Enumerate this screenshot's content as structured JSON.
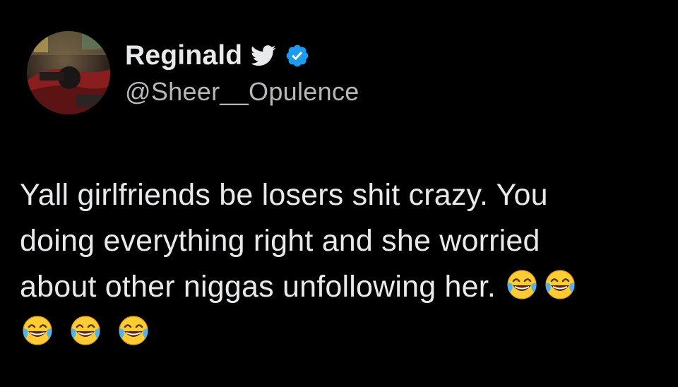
{
  "tweet": {
    "display_name": "Reginald",
    "handle": "@Sheer__Opulence",
    "text_lines": [
      "Yall girlfriends be losers shit crazy. You",
      "doing everything right and she worried",
      "about other niggas unfollowing her."
    ],
    "emoji_name": "face-with-tears-of-joy",
    "emoji_count_line3": 2,
    "emoji_count_line4": 3
  },
  "icons": {
    "bird": "twitter-bird-icon",
    "verified": "verified-badge-icon"
  },
  "colors": {
    "background": "#000000",
    "text_primary": "#e7e9ea",
    "text_secondary": "#b5b8bb",
    "verified_blue": "#1d9bf0"
  }
}
